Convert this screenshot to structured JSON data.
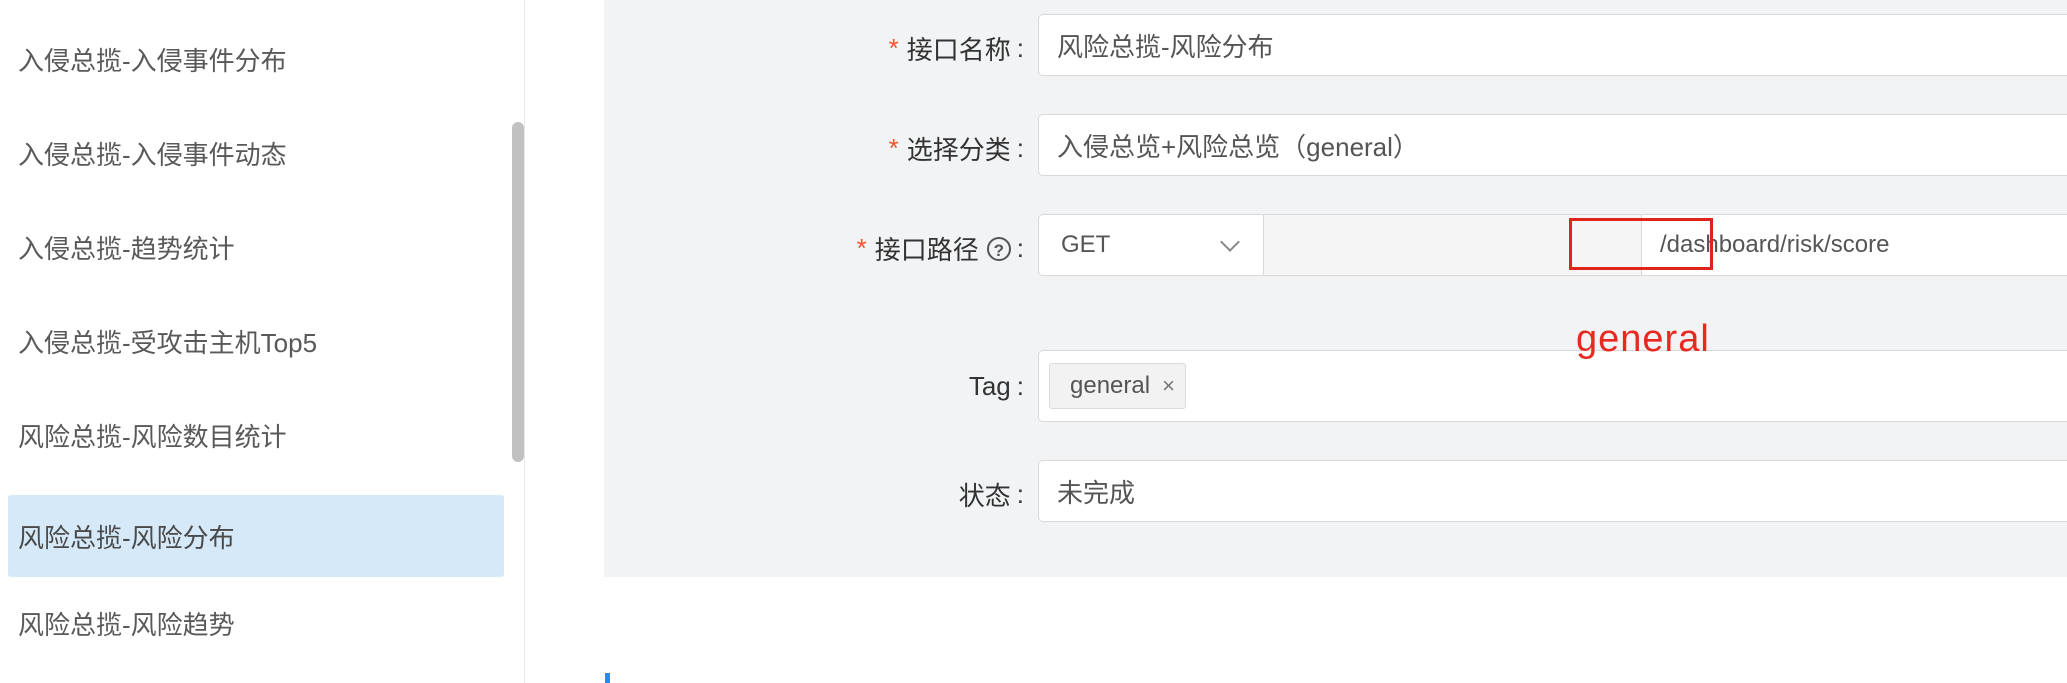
{
  "sidebar": {
    "items": [
      {
        "label": "入侵总揽-入侵事件分布",
        "active": false
      },
      {
        "label": "入侵总揽-入侵事件动态",
        "active": false
      },
      {
        "label": "入侵总揽-趋势统计",
        "active": false
      },
      {
        "label": "入侵总揽-受攻击主机Top5",
        "active": false
      },
      {
        "label": "风险总揽-风险数目统计",
        "active": false
      },
      {
        "label": "风险总揽-风险分布",
        "active": true
      },
      {
        "label": "风险总揽-风险趋势",
        "active": false
      }
    ]
  },
  "form": {
    "name": {
      "required_mark": "*",
      "label": "接口名称",
      "colon": ":",
      "value": "风险总揽-风险分布"
    },
    "category": {
      "required_mark": "*",
      "label": "选择分类",
      "colon": ":",
      "value": "入侵总览+风险总览（general）"
    },
    "path": {
      "required_mark": "*",
      "label": "接口路径",
      "help_icon": "?",
      "colon": ":",
      "method": "GET",
      "base_path": "",
      "value": "/dashboard/risk/score"
    },
    "tag": {
      "label": "Tag",
      "colon": ":",
      "chips": [
        {
          "label": "general",
          "close": "×"
        }
      ]
    },
    "status": {
      "label": "状态",
      "colon": ":",
      "value": "未完成"
    }
  },
  "annotation": {
    "text": "general",
    "color": "#e8291f"
  },
  "colors": {
    "accent": "#1890ff",
    "required": "#f2552c",
    "active_item_bg": "#d6e9f8",
    "panel_bg": "#f2f3f4"
  }
}
